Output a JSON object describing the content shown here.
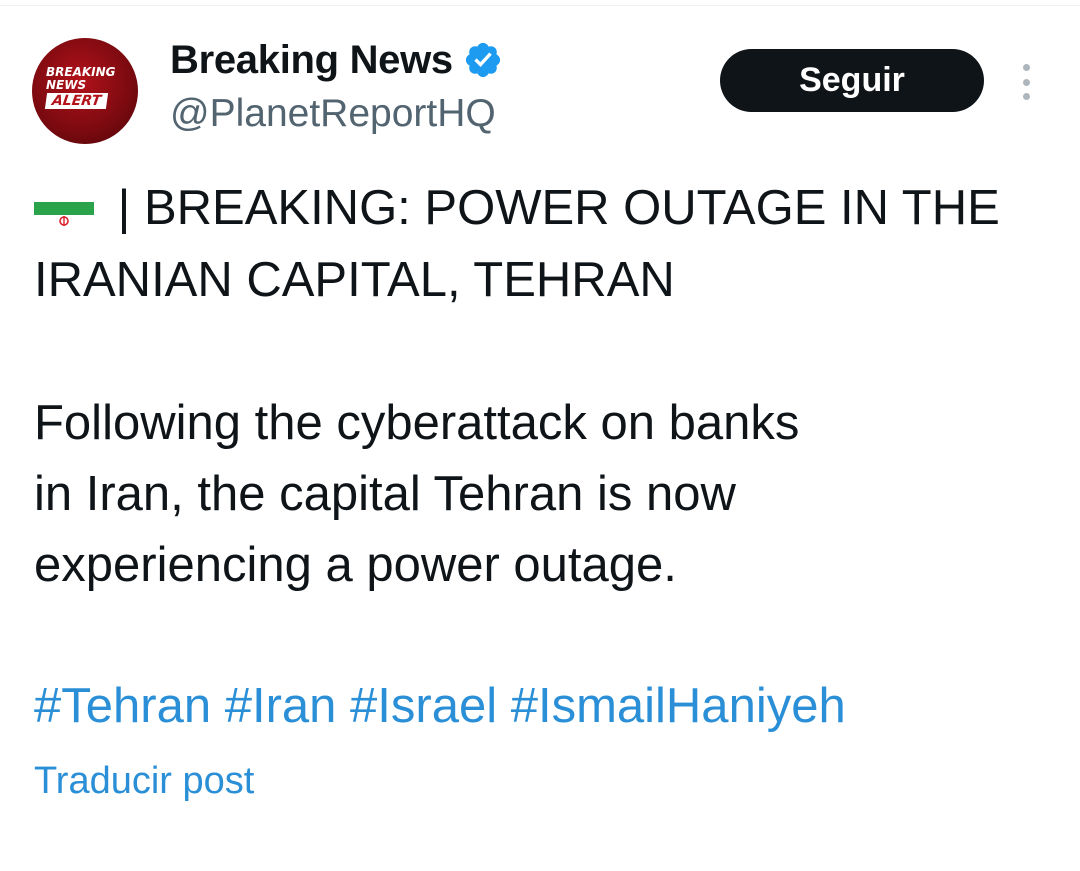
{
  "avatar": {
    "line1": "BREAKING",
    "line2": "NEWS",
    "line3": "ALERT"
  },
  "header": {
    "display_name": "Breaking News",
    "handle": "@PlanetReportHQ",
    "follow_label": "Seguir",
    "verified_icon": "verified-badge-icon",
    "more_icon": "more-vertical-icon"
  },
  "tweet": {
    "flag_icon": "iran-flag-icon",
    "headline_line1": " | BREAKING: POWER OUTAGE IN THE",
    "headline_line2": "IRANIAN CAPITAL, TEHRAN",
    "para_line1": "Following the cyberattack on banks",
    "para_line2": "in Iran, the capital Tehran is now",
    "para_line3": "experiencing a power outage.",
    "hashtags": [
      "#Tehran",
      "#Iran",
      "#Israel",
      "#IsmailHaniyeh"
    ]
  },
  "translate_label": "Traducir post",
  "colors": {
    "link": "#2a8fd6",
    "verified": "#1d9bf0",
    "button_bg": "#0f1419",
    "handle": "#536471"
  }
}
